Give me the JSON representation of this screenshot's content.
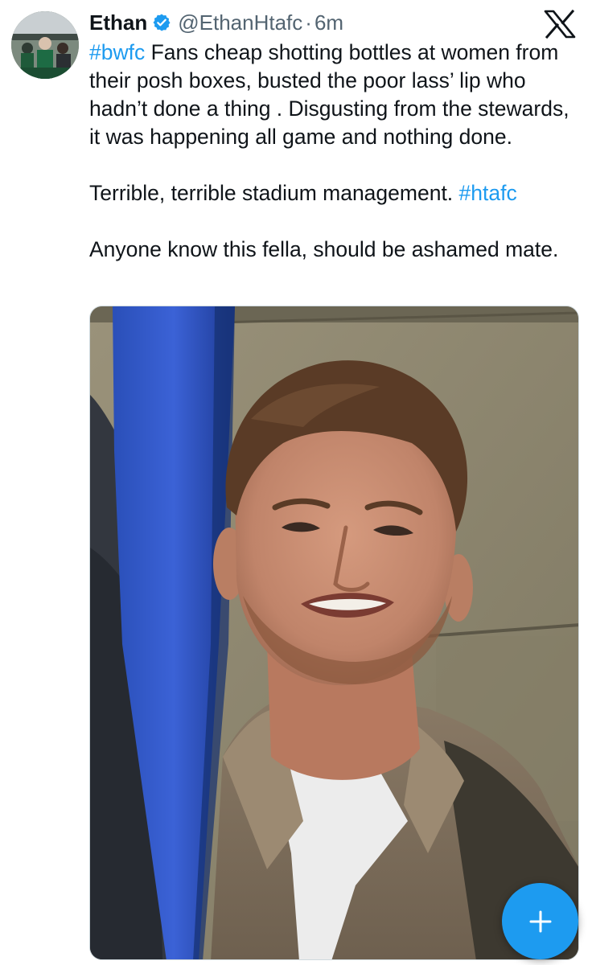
{
  "tweet": {
    "author_name": "Ethan",
    "handle": "@EthanHtafc",
    "separator": "·",
    "time": "6m",
    "paragraph1": {
      "hashtag": "#bwfc",
      "text": " Fans cheap shotting bottles at women from their posh boxes, busted the poor lass’ lip who hadn’t done a thing  . Disgusting from the stewards, it was happening all game and nothing done."
    },
    "paragraph2": {
      "text": "Terrible, terrible stadium management. ",
      "hashtag": "#htafc"
    },
    "paragraph3": {
      "text": "Anyone know this fella, should be ashamed mate."
    }
  },
  "icons": {
    "verified": "verified-badge-icon",
    "close": "x-logo-icon",
    "compose": "plus-icon"
  },
  "colors": {
    "accent": "#1d9bf0",
    "text": "#0f1419",
    "secondary": "#536471"
  }
}
